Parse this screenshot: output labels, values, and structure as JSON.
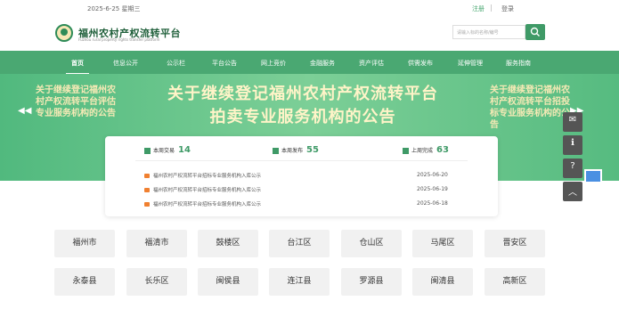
{
  "topbar": {
    "date": "2025-6-25 星期三",
    "login": "注册",
    "register": "登录"
  },
  "header": {
    "title": "福州农村产权流转平台",
    "subtitle": "Fuzhou rural property rights transfer platform",
    "search_placeholder": "请输入标的名称/编号"
  },
  "nav": [
    "首页",
    "信息公开",
    "公示栏",
    "平台公告",
    "网上竞价",
    "金融服务",
    "资产评估",
    "供需发布",
    "延伸管理",
    "服务指南"
  ],
  "banner": {
    "left": "关于继续登记福州农村产权流转平台评估专业服务机构的公告",
    "main_line1": "关于继续登记福州农村产权流转平台",
    "main_line2": "拍卖专业服务机构的公告",
    "right": "关于继续登记福州农村产权流转平台招投标专业服务机构的公告"
  },
  "stats": [
    {
      "label": "本周交易",
      "value": "14"
    },
    {
      "label": "本周发布",
      "value": "55"
    },
    {
      "label": "上周完成",
      "value": "63"
    }
  ],
  "notices": [
    {
      "title": "福州农村产权流转平台招标专业服务机构入库公示",
      "date": "2025-06-20"
    },
    {
      "title": "福州农村产权流转平台招标专业服务机构入库公示",
      "date": "2025-06-19"
    },
    {
      "title": "福州农村产权流转平台招标专业服务机构入库公示",
      "date": "2025-06-18"
    }
  ],
  "districts_row1": [
    "福州市",
    "福清市",
    "鼓楼区",
    "台江区",
    "仓山区",
    "马尾区",
    "晋安区"
  ],
  "districts_row2": [
    "永泰县",
    "长乐区",
    "闽侯县",
    "连江县",
    "罗源县",
    "闽清县",
    "高新区"
  ]
}
